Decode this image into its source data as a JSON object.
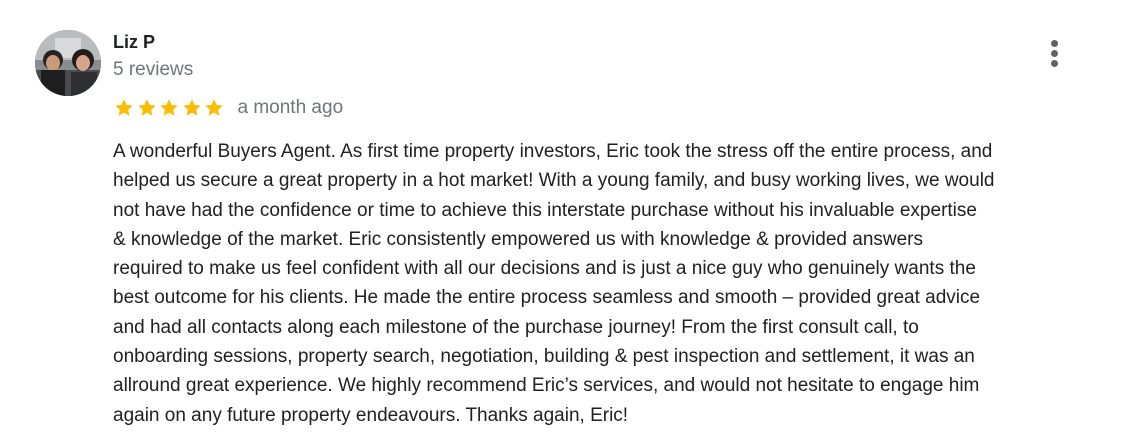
{
  "reviewer": {
    "name": "Liz P",
    "review_count": "5 reviews"
  },
  "rating": {
    "stars": 5,
    "max": 5,
    "color": "#fbbc04",
    "date": "a month ago"
  },
  "menu": {
    "icon": "more-vert-icon"
  },
  "review": {
    "lines": [
      "A wonderful Buyers Agent. As first time property investors, Eric took the stress off the entire process, and",
      "helped us secure a great property in a hot market! With a young family, and busy working lives, we would",
      "not have had the confidence or time to achieve this interstate purchase without his invaluable expertise",
      "& knowledge of the market. Eric consistently empowered us with knowledge & provided answers",
      "required to make us feel confident with all our decisions and is just a nice guy who genuinely wants the",
      "best outcome for his clients. He made the entire process seamless and smooth – provided great advice",
      "and had all contacts along each milestone of the purchase journey! From the first consult call, to",
      "onboarding sessions, property search, negotiation, building & pest inspection and settlement, it was an",
      "allround great experience. We highly recommend Eric’s services, and would not hesitate to engage him",
      "again on any future property endeavours. Thanks again, Eric!"
    ]
  }
}
